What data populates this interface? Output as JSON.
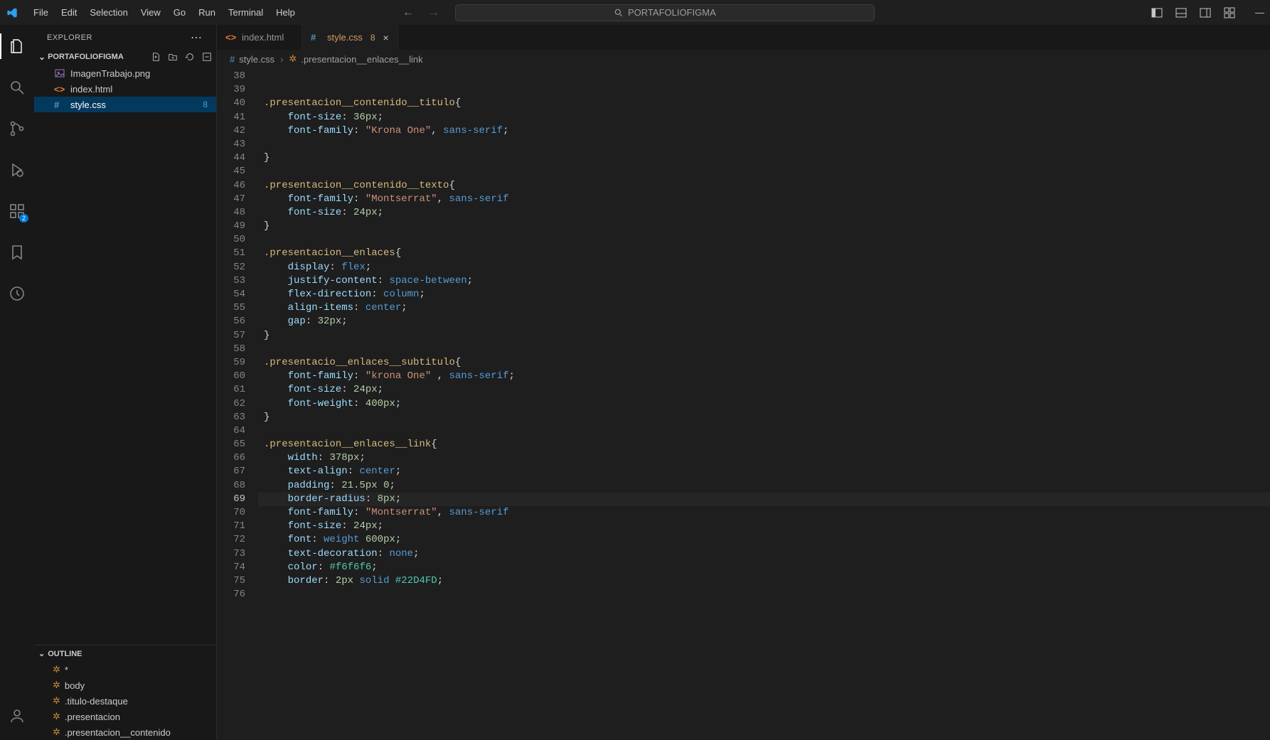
{
  "menu": {
    "items": [
      "File",
      "Edit",
      "Selection",
      "View",
      "Go",
      "Run",
      "Terminal",
      "Help"
    ]
  },
  "search": {
    "placeholder": "PORTAFOLIOFIGMA"
  },
  "explorer": {
    "title": "EXPLORER",
    "folder": "PORTAFOLIOFIGMA",
    "files": [
      {
        "name": "ImagenTrabajo.png",
        "icon": "image"
      },
      {
        "name": "index.html",
        "icon": "html"
      },
      {
        "name": "style.css",
        "icon": "css",
        "selected": true,
        "git": "8"
      }
    ]
  },
  "outline": {
    "title": "OUTLINE",
    "items": [
      "*",
      "body",
      ".titulo-destaque",
      ".presentacion",
      ".presentacion__contenido"
    ]
  },
  "tabs": {
    "items": [
      {
        "label": "index.html",
        "icon": "html",
        "active": false
      },
      {
        "label": "style.css",
        "icon": "css",
        "active": true,
        "modified": "8"
      }
    ]
  },
  "breadcrumb": {
    "parts": [
      "style.css",
      ".presentacion__enlaces__link"
    ]
  },
  "code": {
    "startLine": 38,
    "currentLine": 69,
    "lines": [
      {
        "n": 38,
        "t": "    "
      },
      {
        "n": 39,
        "t": ""
      },
      {
        "n": 40,
        "s": ".presentacion__contenido__titulo",
        "b": "{"
      },
      {
        "n": 41,
        "p": "font-size",
        "v": "36px",
        "end": ";",
        "indent": 1
      },
      {
        "n": 42,
        "p": "font-family",
        "raw": [
          {
            "c": "str",
            "t": "\"Krona One\""
          },
          {
            "c": "punc",
            "t": ", "
          },
          {
            "c": "kw",
            "t": "sans-serif"
          },
          {
            "c": "punc",
            "t": ";"
          }
        ],
        "indent": 1
      },
      {
        "n": 43,
        "t": "",
        "indent": 1
      },
      {
        "n": 44,
        "b": "}"
      },
      {
        "n": 45,
        "t": ""
      },
      {
        "n": 46,
        "s": ".presentacion__contenido__texto",
        "b": "{"
      },
      {
        "n": 47,
        "p": "font-family",
        "raw": [
          {
            "c": "str",
            "t": "\"Montserrat\""
          },
          {
            "c": "punc",
            "t": ", "
          },
          {
            "c": "kw",
            "t": "sans-serif"
          }
        ],
        "indent": 1
      },
      {
        "n": 48,
        "p": "font-size",
        "v": "24px",
        "end": ";",
        "indent": 1
      },
      {
        "n": 49,
        "b": "}"
      },
      {
        "n": 50,
        "t": ""
      },
      {
        "n": 51,
        "s": ".presentacion__enlaces",
        "b": "{"
      },
      {
        "n": 52,
        "p": "display",
        "raw": [
          {
            "c": "kw",
            "t": "flex"
          },
          {
            "c": "punc",
            "t": ";"
          }
        ],
        "indent": 1
      },
      {
        "n": 53,
        "p": "justify-content",
        "raw": [
          {
            "c": "kw",
            "t": "space-between"
          },
          {
            "c": "punc",
            "t": ";"
          }
        ],
        "indent": 1
      },
      {
        "n": 54,
        "p": "flex-direction",
        "raw": [
          {
            "c": "kw",
            "t": "column"
          },
          {
            "c": "punc",
            "t": ";"
          }
        ],
        "indent": 1
      },
      {
        "n": 55,
        "p": "align-items",
        "raw": [
          {
            "c": "kw",
            "t": "center"
          },
          {
            "c": "punc",
            "t": ";"
          }
        ],
        "indent": 1
      },
      {
        "n": 56,
        "p": "gap",
        "v": "32px",
        "end": ";",
        "indent": 1
      },
      {
        "n": 57,
        "b": "}"
      },
      {
        "n": 58,
        "t": ""
      },
      {
        "n": 59,
        "s": ".presentacio__enlaces__subtitulo",
        "b": "{"
      },
      {
        "n": 60,
        "p": "font-family",
        "raw": [
          {
            "c": "str",
            "t": "\"krona One\""
          },
          {
            "c": "punc",
            "t": " , "
          },
          {
            "c": "kw",
            "t": "sans-serif"
          },
          {
            "c": "punc",
            "t": ";"
          }
        ],
        "indent": 1
      },
      {
        "n": 61,
        "p": "font-size",
        "v": "24px",
        "end": ";",
        "indent": 1
      },
      {
        "n": 62,
        "p": "font-weight",
        "v": "400px",
        "end": ";",
        "indent": 1
      },
      {
        "n": 63,
        "b": "}"
      },
      {
        "n": 64,
        "t": ""
      },
      {
        "n": 65,
        "s": ".presentacion__enlaces__link",
        "b": "{"
      },
      {
        "n": 66,
        "p": "width",
        "v": "378px",
        "end": ";",
        "indent": 1
      },
      {
        "n": 67,
        "p": "text-align",
        "raw": [
          {
            "c": "kw",
            "t": "center"
          },
          {
            "c": "punc",
            "t": ";"
          }
        ],
        "indent": 1
      },
      {
        "n": 68,
        "p": "padding",
        "raw": [
          {
            "c": "num",
            "t": "21.5px"
          },
          {
            "c": "punc",
            "t": " "
          },
          {
            "c": "num",
            "t": "0"
          },
          {
            "c": "punc",
            "t": ";"
          }
        ],
        "indent": 1
      },
      {
        "n": 69,
        "p": "border-radius",
        "v": "8px",
        "end": ";",
        "indent": 1,
        "hl": true
      },
      {
        "n": 70,
        "p": "font-family",
        "raw": [
          {
            "c": "str",
            "t": "\"Montserrat\""
          },
          {
            "c": "punc",
            "t": ", "
          },
          {
            "c": "kw",
            "t": "sans-serif"
          }
        ],
        "indent": 1
      },
      {
        "n": 71,
        "p": "font-size",
        "v": "24px",
        "end": ";",
        "indent": 1
      },
      {
        "n": 72,
        "p": "font",
        "raw": [
          {
            "c": "punc",
            "t": ": "
          },
          {
            "c": "kw",
            "t": "weight"
          },
          {
            "c": "punc",
            "t": " "
          },
          {
            "c": "num",
            "t": "600px"
          },
          {
            "c": "punc",
            "t": ";"
          }
        ],
        "indent": 1,
        "noColon": true
      },
      {
        "n": 73,
        "p": "text-decoration",
        "raw": [
          {
            "c": "kw",
            "t": "none"
          },
          {
            "c": "punc",
            "t": ";"
          }
        ],
        "indent": 1
      },
      {
        "n": 74,
        "p": "color",
        "raw": [
          {
            "c": "punc",
            "t": ": "
          },
          {
            "c": "col",
            "t": "#f6f6f6"
          },
          {
            "c": "punc",
            "t": ";"
          }
        ],
        "indent": 1,
        "noColon": true
      },
      {
        "n": 75,
        "p": "border",
        "raw": [
          {
            "c": "punc",
            "t": ": "
          },
          {
            "c": "num",
            "t": "2px"
          },
          {
            "c": "punc",
            "t": " "
          },
          {
            "c": "kw",
            "t": "solid"
          },
          {
            "c": "punc",
            "t": " "
          },
          {
            "c": "col",
            "t": "#22D4FD"
          },
          {
            "c": "punc",
            "t": ";"
          }
        ],
        "indent": 1,
        "noColon": true
      },
      {
        "n": 76,
        "t": "",
        "indent": 1
      }
    ]
  },
  "activity": {
    "badge": "2"
  }
}
